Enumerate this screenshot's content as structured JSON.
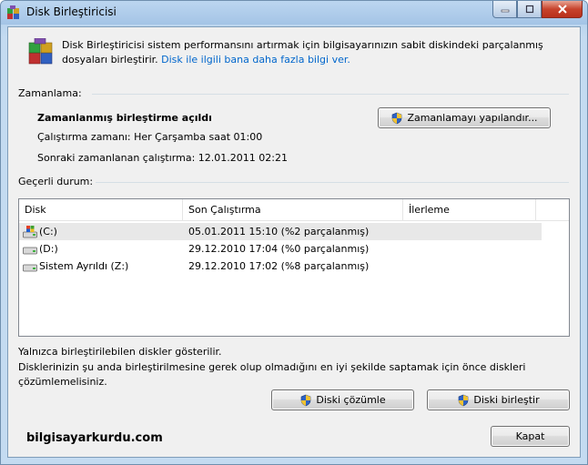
{
  "window": {
    "title": "Disk Birleştiricisi"
  },
  "intro": {
    "text": "Disk Birleştiricisi sistem performansını artırmak için bilgisayarınızın sabit diskindeki parçalanmış dosyaları birleştirir.",
    "link": "Disk ile ilgili bana daha fazla bilgi ver."
  },
  "schedule": {
    "section_label": "Zamanlama:",
    "status": "Zamanlanmış birleştirme açıldı",
    "run_time": "Çalıştırma zamanı: Her Çarşamba saat 01:00",
    "next_run": "Sonraki zamanlanan çalıştırma: 12.01.2011 02:21",
    "configure_button": "Zamanlamayı yapılandır..."
  },
  "current": {
    "section_label": "Geçerli durum:",
    "columns": [
      "Disk",
      "Son Çalıştırma",
      "İlerleme"
    ],
    "rows": [
      {
        "disk": "(C:)",
        "last_run": "05.01.2011 15:10 (%2 parçalanmış)",
        "progress": "",
        "icon": "system-drive-icon"
      },
      {
        "disk": "(D:)",
        "last_run": "29.12.2010 17:04 (%0 parçalanmış)",
        "progress": "",
        "icon": "drive-icon"
      },
      {
        "disk": "Sistem Ayrıldı (Z:)",
        "last_run": "29.12.2010 17:02 (%8 parçalanmış)",
        "progress": "",
        "icon": "drive-icon"
      }
    ]
  },
  "footer": {
    "note1": "Yalnızca birleştirilebilen diskler gösterilir.",
    "note2": "Disklerinizin şu anda birleştirilmesine gerek olup olmadığını en iyi şekilde saptamak için önce diskleri çözümlemelisiniz.",
    "analyze_button": "Diski çözümle",
    "defrag_button": "Diski birleştir",
    "close_button": "Kapat",
    "watermark": "bilgisayarkurdu.com"
  }
}
